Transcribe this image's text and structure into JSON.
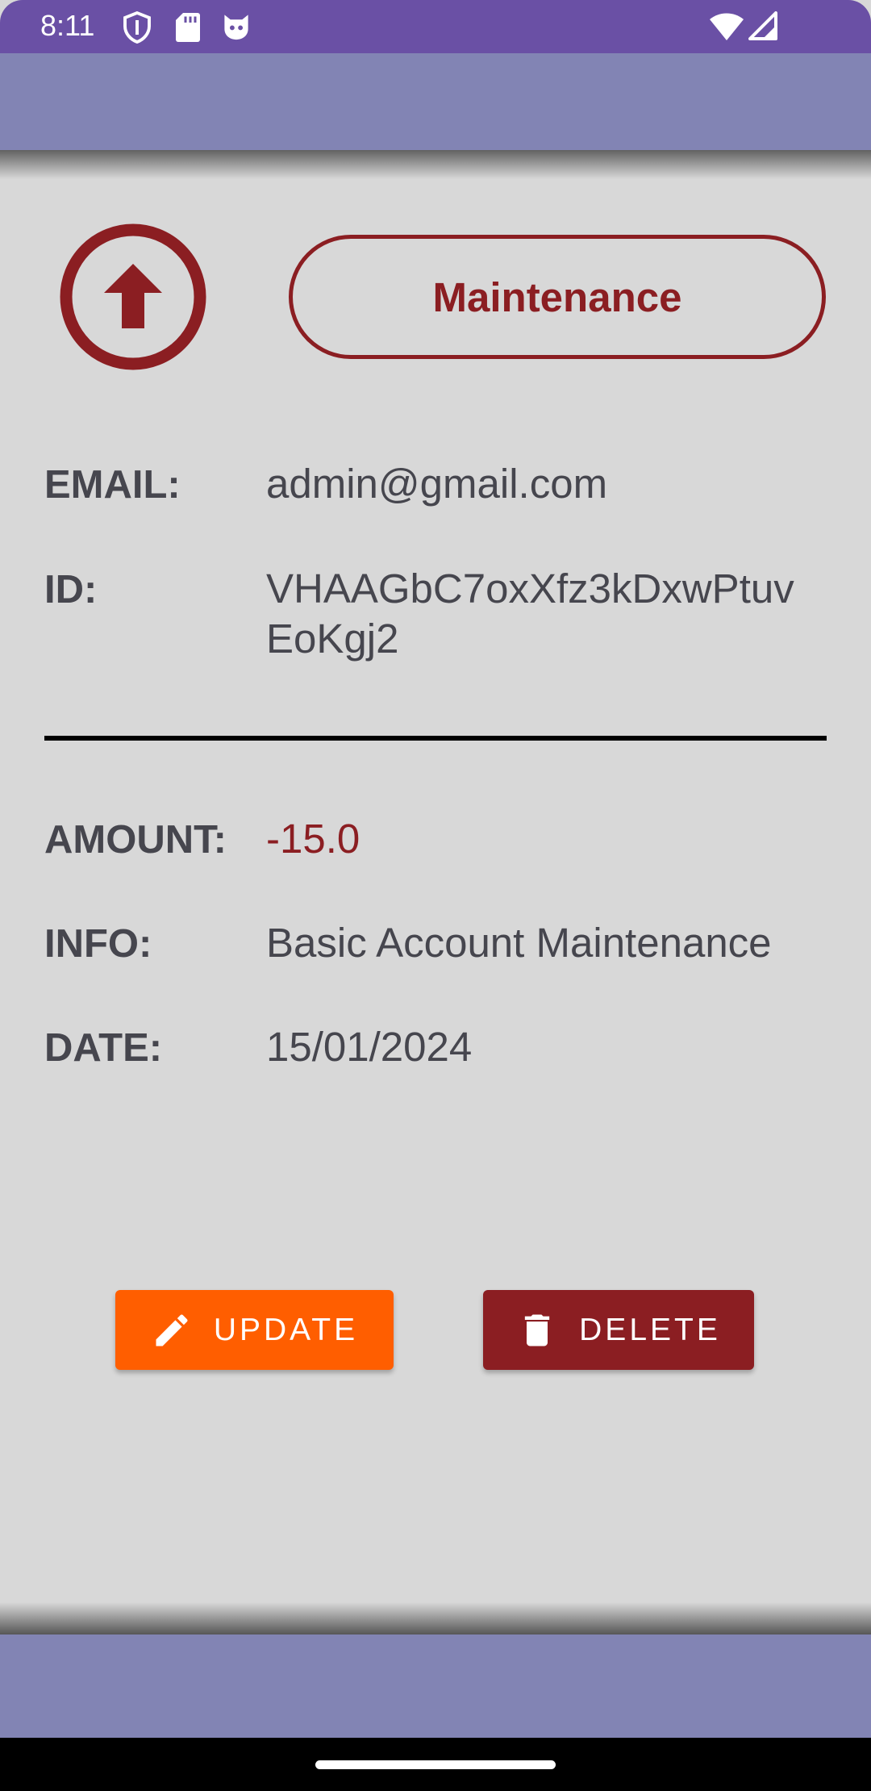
{
  "status_bar": {
    "time": "8:11",
    "icons": [
      "shield-icon",
      "sd-card-icon",
      "cat-face-icon",
      "wifi-icon",
      "signal-icon"
    ]
  },
  "transaction": {
    "direction_icon": "arrow-up-circle-icon",
    "category": "Maintenance",
    "email_label": "EMAIL:",
    "email": "admin@gmail.com",
    "id_label": "ID:",
    "id_line1": "VHAAGbC7oxXfz3kDxwPtuv",
    "id_line2": "EoKgj2",
    "amount_label": "AMOUNT:",
    "amount": "-15.0",
    "info_label": "INFO:",
    "info": "Basic Account Maintenance",
    "date_label": "DATE:",
    "date": "15/01/2024"
  },
  "actions": {
    "update_label": "UPDATE",
    "delete_label": "DELETE"
  },
  "colors": {
    "status_bar": "#6a50a5",
    "app_bar": "#8284b4",
    "background": "#d8d8d8",
    "accent_red": "#8b1e22",
    "update_orange": "#ff5e00",
    "text": "#46464e"
  }
}
